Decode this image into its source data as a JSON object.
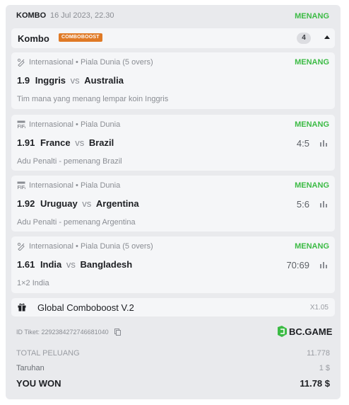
{
  "header": {
    "kind": "KOMBO",
    "date": "16 Jul 2023, 22.30",
    "status": "MENANG"
  },
  "combo": {
    "title": "Kombo",
    "badge": "COMBOBOOST",
    "count": "4"
  },
  "bets": [
    {
      "icon": "cricket-icon",
      "league": "Internasional • Piala Dunia (5 overs)",
      "status": "MENANG",
      "odds": "1.9",
      "home": "Inggris",
      "vs": "vs",
      "away": "Australia",
      "score": "",
      "market": "Tim mana yang menang lempar koin Inggris"
    },
    {
      "icon": "fifa-icon",
      "league": "Internasional • Piala Dunia",
      "status": "MENANG",
      "odds": "1.91",
      "home": "France",
      "vs": "vs",
      "away": "Brazil",
      "score": "4:5",
      "market": "Adu Penalti - pemenang Brazil"
    },
    {
      "icon": "fifa-icon",
      "league": "Internasional • Piala Dunia",
      "status": "MENANG",
      "odds": "1.92",
      "home": "Uruguay",
      "vs": "vs",
      "away": "Argentina",
      "score": "5:6",
      "market": "Adu Penalti - pemenang Argentina"
    },
    {
      "icon": "cricket-icon",
      "league": "Internasional • Piala Dunia (5 overs)",
      "status": "MENANG",
      "odds": "1.61",
      "home": "India",
      "vs": "vs",
      "away": "Bangladesh",
      "score": "70:69",
      "market": "1×2 India"
    }
  ],
  "boost": {
    "label": "Global Comboboost V.2",
    "multiplier": "X1.05"
  },
  "ticket": {
    "id_text": "ID Tiket: 2292384272746681040"
  },
  "brand": {
    "name": "BC.GAME",
    "color": "#3cbb45"
  },
  "summary": {
    "total_odds_label": "TOTAL PELUANG",
    "total_odds_value": "11.778",
    "stake_label": "Taruhan",
    "stake_value": "1 $",
    "won_label": "YOU WON",
    "won_value": "11.78 $"
  },
  "colors": {
    "win": "#3cbb45",
    "boost_badge": "#e07a26",
    "panel": "#e9eaed",
    "card": "#f5f6f8"
  }
}
